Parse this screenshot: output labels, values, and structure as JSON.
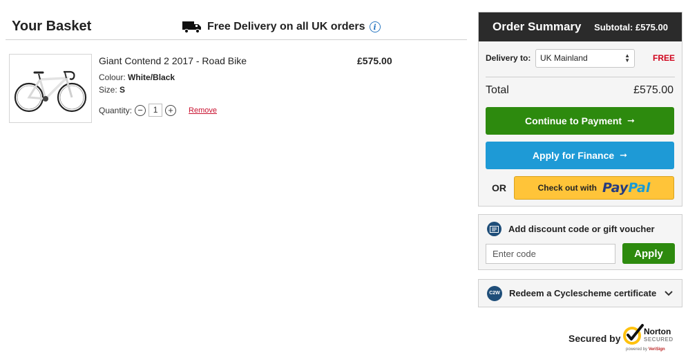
{
  "basket": {
    "title": "Your Basket",
    "free_delivery": "Free Delivery on all UK orders",
    "info_icon": "i"
  },
  "item": {
    "name": "Giant Contend 2 2017 - Road Bike",
    "price": "£575.00",
    "colour_label": "Colour:",
    "colour_value": "White/Black",
    "size_label": "Size:",
    "size_value": "S",
    "quantity_label": "Quantity:",
    "quantity_value": "1",
    "minus": "−",
    "plus": "+",
    "remove": "Remove"
  },
  "summary": {
    "title": "Order Summary",
    "subtotal": "Subtotal: £575.00",
    "delivery_label": "Delivery to:",
    "delivery_selected": "UK Mainland",
    "delivery_cost": "FREE",
    "total_label": "Total",
    "total_value": "£575.00",
    "continue_button": "Continue to Payment",
    "finance_button": "Apply for Finance",
    "or_label": "OR",
    "paypal_prefix": "Check out with",
    "paypal_pay": "Pay",
    "paypal_pal": "Pal"
  },
  "discount": {
    "title": "Add discount code or gift voucher",
    "placeholder": "Enter code",
    "apply_button": "Apply"
  },
  "cyclescheme": {
    "badge": "C2W",
    "label": "Redeem a Cyclescheme certificate"
  },
  "security": {
    "secured_by": "Secured by",
    "norton": "Norton",
    "norton_sub": "SECURED",
    "powered_prefix": "powered by",
    "powered_brand": "VeriSign"
  },
  "icons": {
    "delivery": "truck-icon",
    "info": "info-icon",
    "arrow": "arrow-right-icon",
    "discount": "voucher-icon",
    "cyclescheme": "c2w-icon",
    "expand": "chevron-down-icon",
    "norton": "norton-check-icon"
  },
  "colors": {
    "green": "#2d8a0e",
    "blue": "#1e9ad6",
    "paypal_yellow": "#ffc439",
    "header_dark": "#2b2b2b",
    "free_red": "#d0021b"
  }
}
